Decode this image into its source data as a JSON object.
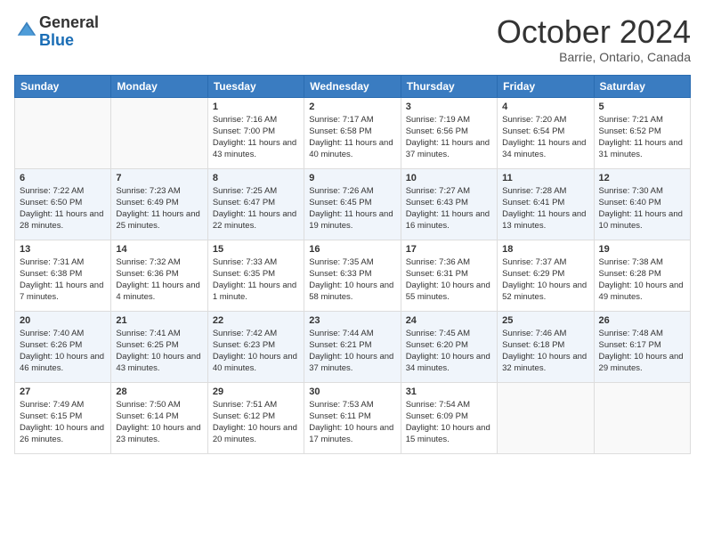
{
  "header": {
    "logo_general": "General",
    "logo_blue": "Blue",
    "month_title": "October 2024",
    "location": "Barrie, Ontario, Canada"
  },
  "weekdays": [
    "Sunday",
    "Monday",
    "Tuesday",
    "Wednesday",
    "Thursday",
    "Friday",
    "Saturday"
  ],
  "weeks": [
    [
      {
        "day": "",
        "info": ""
      },
      {
        "day": "",
        "info": ""
      },
      {
        "day": "1",
        "info": "Sunrise: 7:16 AM\nSunset: 7:00 PM\nDaylight: 11 hours and 43 minutes."
      },
      {
        "day": "2",
        "info": "Sunrise: 7:17 AM\nSunset: 6:58 PM\nDaylight: 11 hours and 40 minutes."
      },
      {
        "day": "3",
        "info": "Sunrise: 7:19 AM\nSunset: 6:56 PM\nDaylight: 11 hours and 37 minutes."
      },
      {
        "day": "4",
        "info": "Sunrise: 7:20 AM\nSunset: 6:54 PM\nDaylight: 11 hours and 34 minutes."
      },
      {
        "day": "5",
        "info": "Sunrise: 7:21 AM\nSunset: 6:52 PM\nDaylight: 11 hours and 31 minutes."
      }
    ],
    [
      {
        "day": "6",
        "info": "Sunrise: 7:22 AM\nSunset: 6:50 PM\nDaylight: 11 hours and 28 minutes."
      },
      {
        "day": "7",
        "info": "Sunrise: 7:23 AM\nSunset: 6:49 PM\nDaylight: 11 hours and 25 minutes."
      },
      {
        "day": "8",
        "info": "Sunrise: 7:25 AM\nSunset: 6:47 PM\nDaylight: 11 hours and 22 minutes."
      },
      {
        "day": "9",
        "info": "Sunrise: 7:26 AM\nSunset: 6:45 PM\nDaylight: 11 hours and 19 minutes."
      },
      {
        "day": "10",
        "info": "Sunrise: 7:27 AM\nSunset: 6:43 PM\nDaylight: 11 hours and 16 minutes."
      },
      {
        "day": "11",
        "info": "Sunrise: 7:28 AM\nSunset: 6:41 PM\nDaylight: 11 hours and 13 minutes."
      },
      {
        "day": "12",
        "info": "Sunrise: 7:30 AM\nSunset: 6:40 PM\nDaylight: 11 hours and 10 minutes."
      }
    ],
    [
      {
        "day": "13",
        "info": "Sunrise: 7:31 AM\nSunset: 6:38 PM\nDaylight: 11 hours and 7 minutes."
      },
      {
        "day": "14",
        "info": "Sunrise: 7:32 AM\nSunset: 6:36 PM\nDaylight: 11 hours and 4 minutes."
      },
      {
        "day": "15",
        "info": "Sunrise: 7:33 AM\nSunset: 6:35 PM\nDaylight: 11 hours and 1 minute."
      },
      {
        "day": "16",
        "info": "Sunrise: 7:35 AM\nSunset: 6:33 PM\nDaylight: 10 hours and 58 minutes."
      },
      {
        "day": "17",
        "info": "Sunrise: 7:36 AM\nSunset: 6:31 PM\nDaylight: 10 hours and 55 minutes."
      },
      {
        "day": "18",
        "info": "Sunrise: 7:37 AM\nSunset: 6:29 PM\nDaylight: 10 hours and 52 minutes."
      },
      {
        "day": "19",
        "info": "Sunrise: 7:38 AM\nSunset: 6:28 PM\nDaylight: 10 hours and 49 minutes."
      }
    ],
    [
      {
        "day": "20",
        "info": "Sunrise: 7:40 AM\nSunset: 6:26 PM\nDaylight: 10 hours and 46 minutes."
      },
      {
        "day": "21",
        "info": "Sunrise: 7:41 AM\nSunset: 6:25 PM\nDaylight: 10 hours and 43 minutes."
      },
      {
        "day": "22",
        "info": "Sunrise: 7:42 AM\nSunset: 6:23 PM\nDaylight: 10 hours and 40 minutes."
      },
      {
        "day": "23",
        "info": "Sunrise: 7:44 AM\nSunset: 6:21 PM\nDaylight: 10 hours and 37 minutes."
      },
      {
        "day": "24",
        "info": "Sunrise: 7:45 AM\nSunset: 6:20 PM\nDaylight: 10 hours and 34 minutes."
      },
      {
        "day": "25",
        "info": "Sunrise: 7:46 AM\nSunset: 6:18 PM\nDaylight: 10 hours and 32 minutes."
      },
      {
        "day": "26",
        "info": "Sunrise: 7:48 AM\nSunset: 6:17 PM\nDaylight: 10 hours and 29 minutes."
      }
    ],
    [
      {
        "day": "27",
        "info": "Sunrise: 7:49 AM\nSunset: 6:15 PM\nDaylight: 10 hours and 26 minutes."
      },
      {
        "day": "28",
        "info": "Sunrise: 7:50 AM\nSunset: 6:14 PM\nDaylight: 10 hours and 23 minutes."
      },
      {
        "day": "29",
        "info": "Sunrise: 7:51 AM\nSunset: 6:12 PM\nDaylight: 10 hours and 20 minutes."
      },
      {
        "day": "30",
        "info": "Sunrise: 7:53 AM\nSunset: 6:11 PM\nDaylight: 10 hours and 17 minutes."
      },
      {
        "day": "31",
        "info": "Sunrise: 7:54 AM\nSunset: 6:09 PM\nDaylight: 10 hours and 15 minutes."
      },
      {
        "day": "",
        "info": ""
      },
      {
        "day": "",
        "info": ""
      }
    ]
  ]
}
